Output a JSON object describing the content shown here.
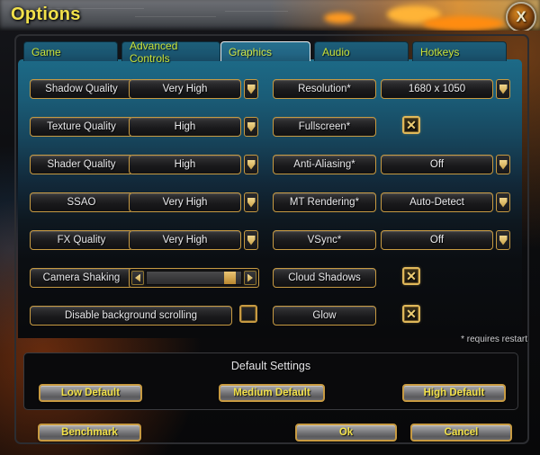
{
  "window": {
    "title": "Options",
    "close_label": "X"
  },
  "tabs": [
    {
      "label": "Game",
      "active": false
    },
    {
      "label": "Advanced Controls",
      "active": false
    },
    {
      "label": "Graphics",
      "active": true
    },
    {
      "label": "Audio",
      "active": false
    },
    {
      "label": "Hotkeys",
      "active": false
    }
  ],
  "settings": {
    "left_column": [
      {
        "label": "Shadow Quality",
        "type": "dropdown",
        "value": "Very High"
      },
      {
        "label": "Texture Quality",
        "type": "dropdown",
        "value": "High"
      },
      {
        "label": "Shader Quality",
        "type": "dropdown",
        "value": "High"
      },
      {
        "label": "SSAO",
        "type": "dropdown",
        "value": "Very High"
      },
      {
        "label": "FX Quality",
        "type": "dropdown",
        "value": "Very High"
      },
      {
        "label": "Camera Shaking",
        "type": "slider",
        "value": 88
      },
      {
        "label": "Disable background scrolling",
        "type": "checkbox",
        "checked": false
      }
    ],
    "right_column": [
      {
        "label": "Resolution*",
        "type": "dropdown",
        "value": "1680 x 1050"
      },
      {
        "label": "Fullscreen*",
        "type": "checkbox",
        "checked": true
      },
      {
        "label": "Anti-Aliasing*",
        "type": "dropdown",
        "value": "Off"
      },
      {
        "label": "MT Rendering*",
        "type": "dropdown",
        "value": "Auto-Detect"
      },
      {
        "label": "VSync*",
        "type": "dropdown",
        "value": "Off"
      },
      {
        "label": "Cloud Shadows",
        "type": "checkbox",
        "checked": true
      },
      {
        "label": "Glow",
        "type": "checkbox",
        "checked": true
      }
    ]
  },
  "restart_note": "* requires restart",
  "defaults": {
    "title": "Default Settings",
    "buttons": [
      {
        "label": "Low Default"
      },
      {
        "label": "Medium Default"
      },
      {
        "label": "High Default"
      }
    ]
  },
  "footer": {
    "benchmark_label": "Benchmark",
    "ok_label": "Ok",
    "cancel_label": "Cancel"
  },
  "icons": {
    "checkbox_mark": "✕",
    "dropdown_arrow": "chevron-down-icon"
  },
  "colors": {
    "gold_border": "#c79a42",
    "gold_text": "#f2e14a",
    "tab_text": "#c9e23a",
    "panel_top": "#1d6a87",
    "panel_bottom": "#090a0c"
  }
}
